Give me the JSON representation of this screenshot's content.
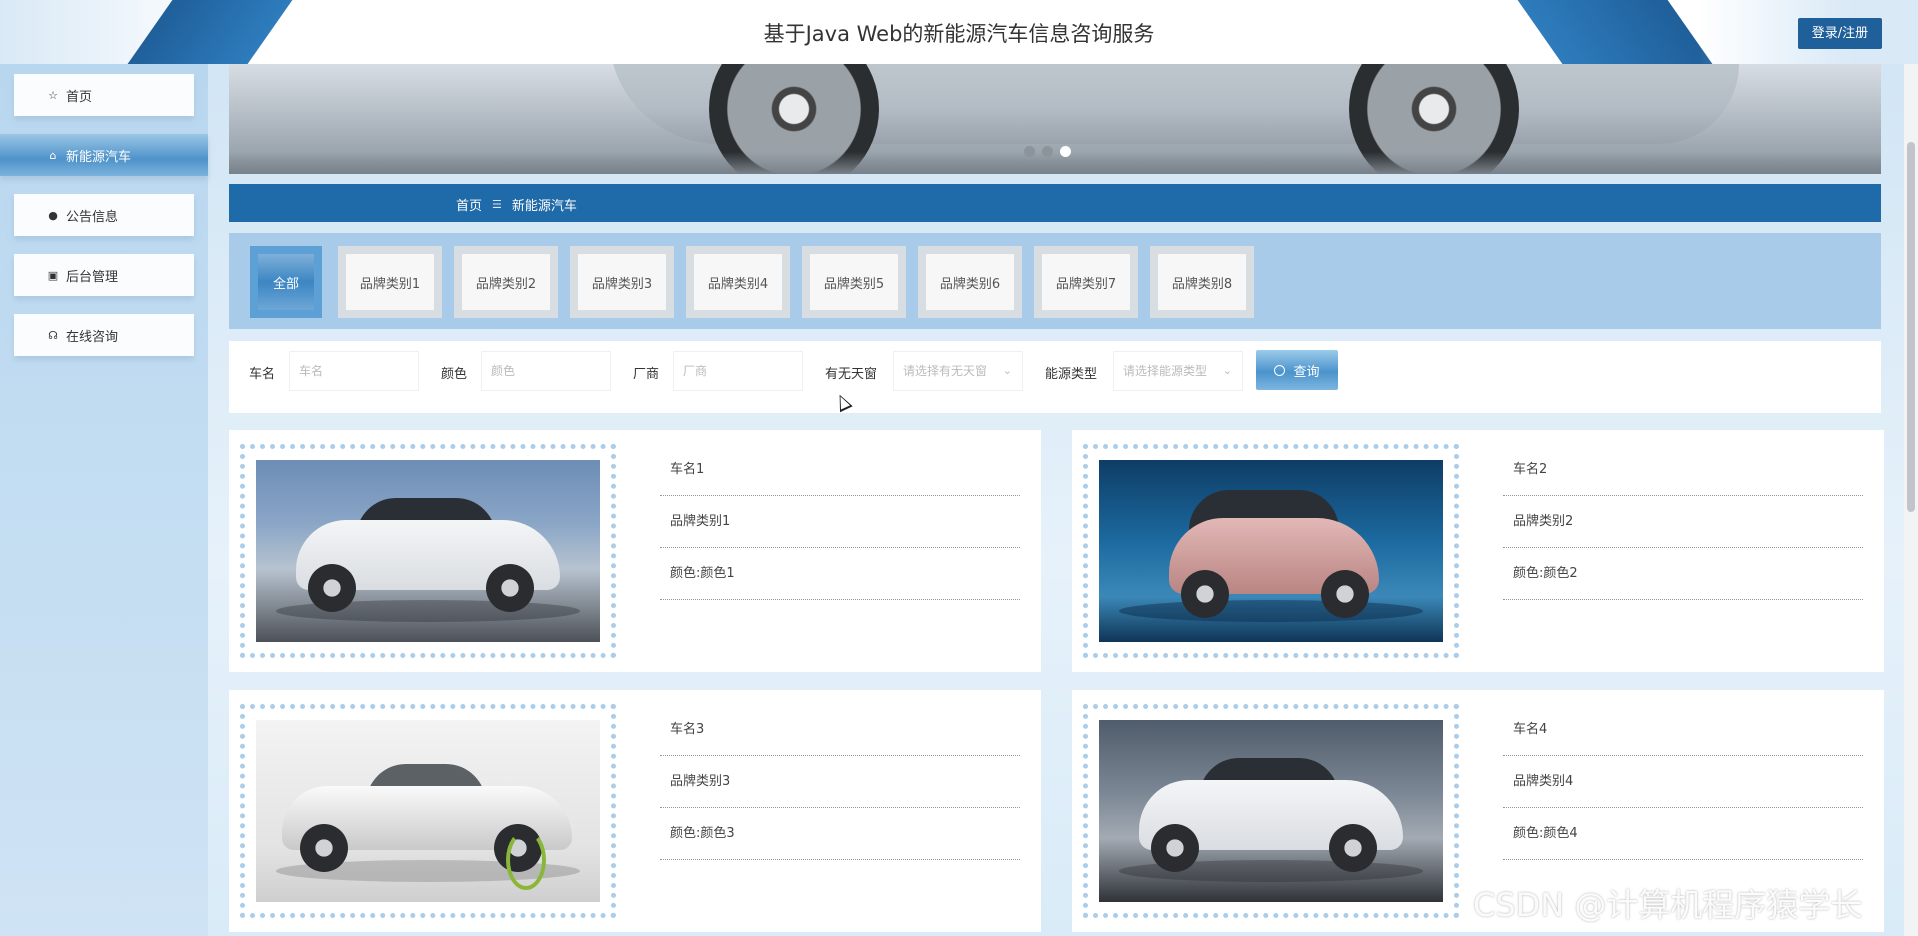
{
  "header": {
    "title": "基于Java Web的新能源汽车信息咨询服务",
    "login_label": "登录/注册"
  },
  "sidebar": {
    "items": [
      {
        "label": "首页",
        "icon": "star-icon"
      },
      {
        "label": "新能源汽车",
        "icon": "bag-icon",
        "active": true
      },
      {
        "label": "公告信息",
        "icon": "info-icon"
      },
      {
        "label": "后台管理",
        "icon": "briefcase-icon"
      },
      {
        "label": "在线咨询",
        "icon": "headset-icon"
      }
    ]
  },
  "banner": {
    "slide_count": 3,
    "active_slide": 3
  },
  "breadcrumb": {
    "home": "首页",
    "separator": "☰",
    "current": "新能源汽车"
  },
  "categories": {
    "items": [
      "全部",
      "品牌类别1",
      "品牌类别2",
      "品牌类别3",
      "品牌类别4",
      "品牌类别5",
      "品牌类别6",
      "品牌类别7",
      "品牌类别8"
    ],
    "active": "全部"
  },
  "search": {
    "name_label": "车名",
    "name_placeholder": "车名",
    "color_label": "颜色",
    "color_placeholder": "颜色",
    "maker_label": "厂商",
    "maker_placeholder": "厂商",
    "sunroof_label": "有无天窗",
    "sunroof_placeholder": "请选择有无天窗",
    "energy_label": "能源类型",
    "energy_placeholder": "请选择能源类型",
    "button_label": "查询"
  },
  "cars": [
    {
      "name": "车名1",
      "brand": "品牌类别1",
      "color": "颜色:颜色1",
      "image": "white-sedan-photo"
    },
    {
      "name": "车名2",
      "brand": "品牌类别2",
      "color": "颜色:颜色2",
      "image": "pink-hatchback-aquarium-photo"
    },
    {
      "name": "车名3",
      "brand": "品牌类别3",
      "color": "颜色:颜色3",
      "image": "electric-concept-car-photo"
    },
    {
      "name": "车名4",
      "brand": "品牌类别4",
      "color": "颜色:颜色4",
      "image": "white-sedan-showroom-photo"
    }
  ],
  "watermark": "CSDN @计算机程序猿学长",
  "colors": {
    "primary": "#1f6aa8",
    "header_button": "#1f5f9a",
    "category_bar": "#a8cbe9",
    "frame_dots": "#a9cdea"
  }
}
